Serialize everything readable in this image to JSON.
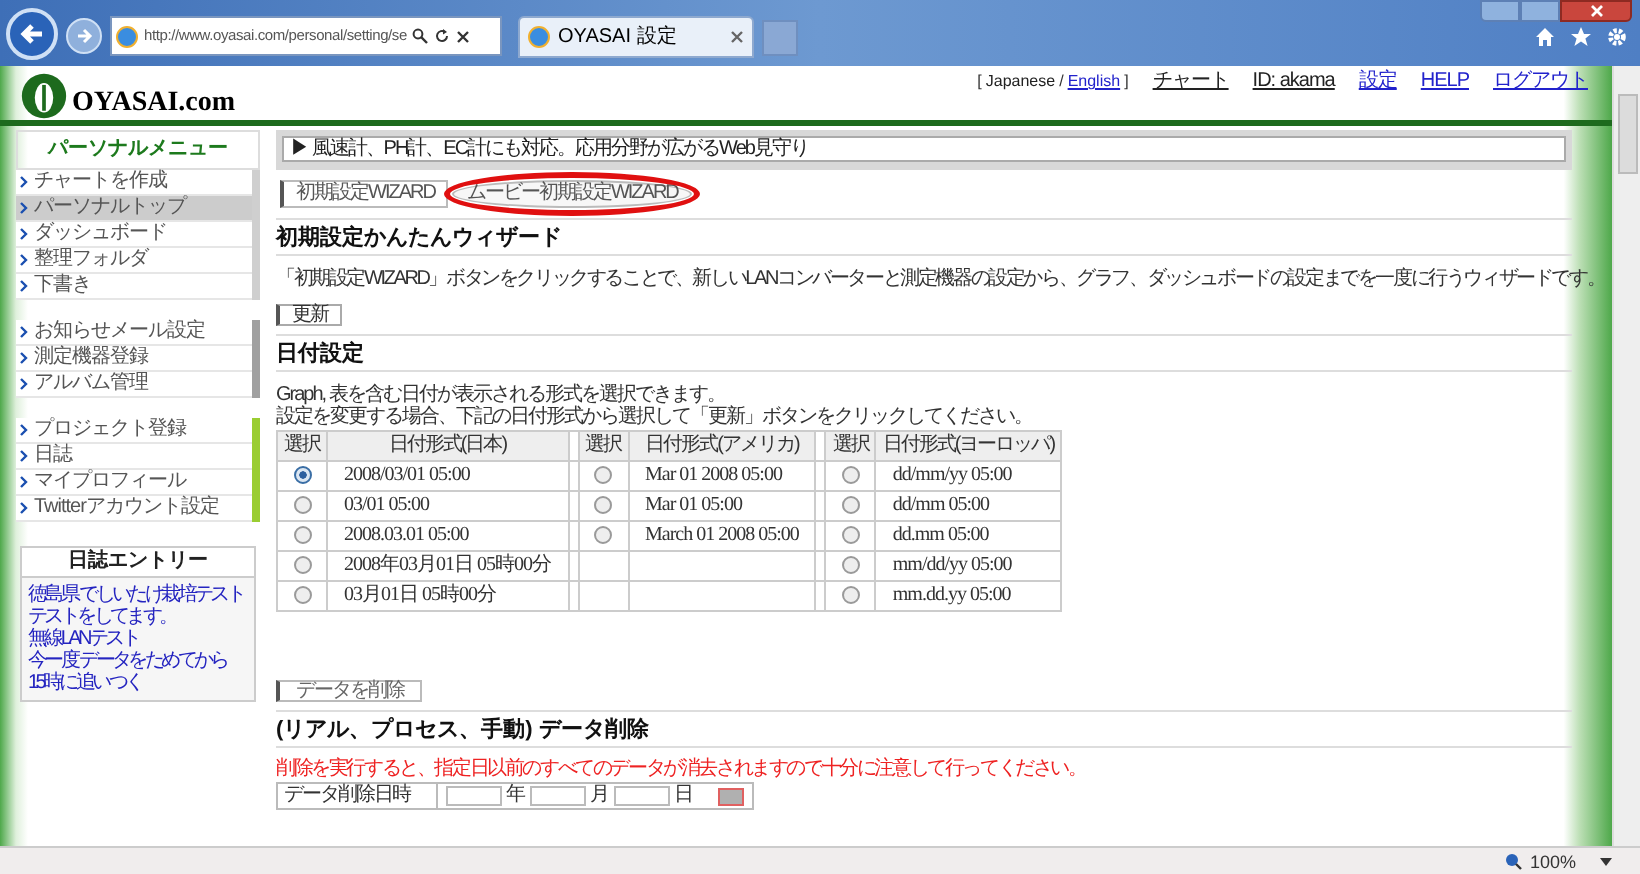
{
  "browser": {
    "address": "http://www.oyasai.com/personal/setting/se",
    "tab_title": "OYASAI 設定",
    "zoom": "100%"
  },
  "header": {
    "logo": "OYASAI.com",
    "language": {
      "open": "[",
      "options": [
        {
          "label": "Japanese",
          "selected": true
        },
        {
          "label": "English",
          "selected": false
        }
      ],
      "separator": "/",
      "close": "]"
    },
    "links": [
      {
        "label": "チャート",
        "kind": "text"
      },
      {
        "label": "ID: akama",
        "kind": "text"
      },
      {
        "label": "設定",
        "kind": "link"
      },
      {
        "label": "HELP",
        "kind": "link"
      },
      {
        "label": "ログアウト",
        "kind": "link"
      }
    ]
  },
  "sidebar": {
    "title": "パーソナルメニュー",
    "groups": [
      {
        "kind": "main",
        "items": [
          {
            "label": "チャートを作成",
            "selected": false
          },
          {
            "label": "パーソナルトップ",
            "selected": true
          },
          {
            "label": "ダッシュボード",
            "selected": false
          },
          {
            "label": "整理フォルダ",
            "selected": false
          },
          {
            "label": "下書き",
            "selected": false
          }
        ]
      },
      {
        "kind": "settings",
        "items": [
          {
            "label": "お知らせメール設定",
            "selected": false
          },
          {
            "label": "測定機器登録",
            "selected": false
          },
          {
            "label": "アルバム管理",
            "selected": false
          }
        ]
      },
      {
        "kind": "project",
        "items": [
          {
            "label": "プロジェクト登録",
            "selected": false
          },
          {
            "label": "日誌",
            "selected": false
          },
          {
            "label": "マイプロフィール",
            "selected": false
          },
          {
            "label": "Twitterアカウント設定",
            "selected": false
          }
        ]
      }
    ],
    "diary": {
      "title": "日誌エントリー",
      "entries": [
        "徳島県 でしいたけ栽培テスト",
        "テストをしてます。",
        "無線LANテスト",
        "今ー度 データをためてから",
        "15時に追いつく"
      ]
    }
  },
  "notice": "▶ 風速計、PH計、EC計にも対応。応用分野が広がるWeb見守り",
  "wizard_tabs": [
    {
      "label": "初期設定WIZARD",
      "selected": true,
      "circled": false
    },
    {
      "label": "ムービー初期設定WIZARD",
      "selected": false,
      "circled": true
    }
  ],
  "wizard_section": {
    "heading": "初期設定かんたんウィザード",
    "description": "「初期設定WIZARD」ボタンをクリックすることで、新しいLANコンバーターと測定機器の設定から、グラフ、ダッシュボードの設定までを一度に行うウィザードです。",
    "button": "更新"
  },
  "date_section": {
    "heading": "日付設定",
    "intro": [
      "Graph, 表を含む日付が表示される形式を選択できます。",
      "設定を変更する場合、下記の日付形式から選択して「更新」ボタンをクリックしてください。"
    ],
    "columns": [
      "選択",
      "日付形式(日本)",
      "選択",
      "日付形式(アメリカ)",
      "選択",
      "日付形式(ヨーロッパ)"
    ],
    "rows": [
      {
        "japan": {
          "text": "2008/03/01 05:00",
          "selected": true
        },
        "america": {
          "text": "Mar 01 2008 05:00",
          "selected": false
        },
        "europe": {
          "text": "dd/mm/yy 05:00",
          "selected": false
        }
      },
      {
        "japan": {
          "text": "03/01 05:00",
          "selected": false
        },
        "america": {
          "text": "Mar 01 05:00",
          "selected": false
        },
        "europe": {
          "text": "dd/mm 05:00",
          "selected": false
        }
      },
      {
        "japan": {
          "text": "2008.03.01 05:00",
          "selected": false
        },
        "america": {
          "text": "March 01 2008 05:00",
          "selected": false
        },
        "europe": {
          "text": "dd.mm 05:00",
          "selected": false
        }
      },
      {
        "japan": {
          "text": "2008年03月01日 05時00分",
          "selected": false
        },
        "europe": {
          "text": "mm/dd/yy 05:00",
          "selected": false
        }
      },
      {
        "japan": {
          "text": "03月01日 05時00分",
          "selected": false
        },
        "europe": {
          "text": "mm.dd.yy 05:00",
          "selected": false
        }
      }
    ]
  },
  "delete_button": "データを削除",
  "delete_section": {
    "heading": "(リアル、プロセス、手動) データ削除",
    "warning": "削除を実行すると、指定日以前のすべてのデータが消去されますので十分に注意して行ってください。",
    "field_label": "データ削除日時",
    "units": [
      "年",
      "月",
      "日"
    ]
  }
}
